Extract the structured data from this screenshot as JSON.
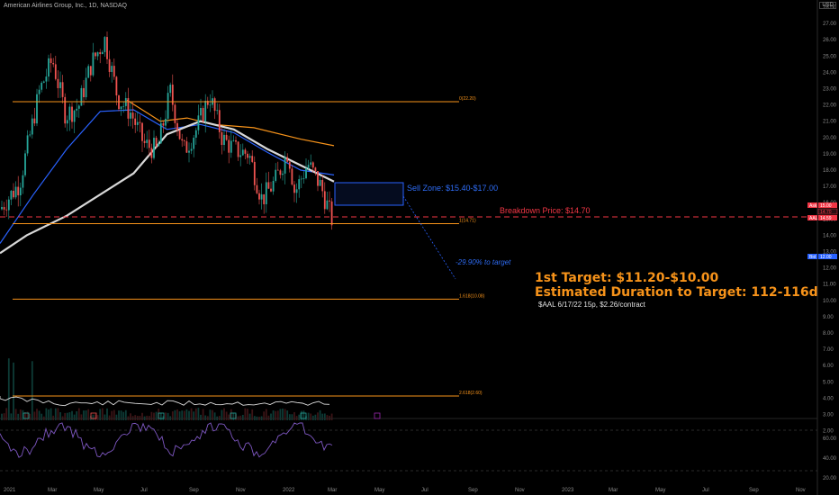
{
  "header": {
    "title": "American Airlines Group, Inc., 1D, NASDAQ",
    "currency": "USD"
  },
  "annotations": {
    "sell_zone": "Sell Zone: $15.40-$17.00",
    "breakdown": "Breakdown Price: $14.70",
    "pct_target": "-29.90% to target",
    "target1": "1st Target: $11.20-$10.00",
    "duration": "Estimated Duration to Target: 112-116d",
    "option": "$AAL 6/17/22 15p, $2.26/contract"
  },
  "fib": [
    {
      "label": "0(22.20)",
      "value": 22.2
    },
    {
      "label": "1(14.71)",
      "value": 14.71
    },
    {
      "label": "1.618(10.08)",
      "value": 10.08
    },
    {
      "label": "2.618(2.60)",
      "value": 2.6
    }
  ],
  "price_tags": {
    "ask": "Ask",
    "ask_val": "15.00",
    "mid_val": "14.70",
    "aal": "AAL",
    "aal_val": "14.59",
    "bid": "Bid",
    "bid_val": "12.00"
  },
  "colors": {
    "bg": "#000000",
    "orange": "#f7931a",
    "blue": "#2962ff",
    "red": "#f23645",
    "purple": "#7e57c2"
  },
  "chart_data": {
    "type": "candlestick",
    "title": "American Airlines Group, Inc., 1D, NASDAQ",
    "x_ticks": [
      "2021",
      "Mar",
      "May",
      "Jul",
      "Sep",
      "Nov",
      "2022",
      "Mar",
      "May",
      "Jul",
      "Sep",
      "Nov",
      "2023",
      "Mar",
      "May",
      "Jul",
      "Sep",
      "Nov"
    ],
    "y_ticks": [
      "28.00",
      "27.00",
      "26.00",
      "25.00",
      "24.00",
      "23.00",
      "22.00",
      "21.00",
      "20.00",
      "19.00",
      "18.00",
      "17.00",
      "16.00",
      "15.00",
      "14.00",
      "13.00",
      "12.00",
      "11.00",
      "10.00",
      "9.00",
      "8.00",
      "7.00",
      "6.00",
      "5.00",
      "4.00",
      "3.00",
      "2.00"
    ],
    "ylim": [
      1.5,
      28.5
    ],
    "rsi_ticks": [
      "60.00",
      "40.00",
      "20.00"
    ],
    "price_path": [
      [
        0,
        15.6
      ],
      [
        0.03,
        17.2
      ],
      [
        0.06,
        22.8
      ],
      [
        0.08,
        24.8
      ],
      [
        0.1,
        21.4
      ],
      [
        0.12,
        21.9
      ],
      [
        0.14,
        24.6
      ],
      [
        0.16,
        26.0
      ],
      [
        0.18,
        22.4
      ],
      [
        0.2,
        21.5
      ],
      [
        0.22,
        19.6
      ],
      [
        0.24,
        19.2
      ],
      [
        0.26,
        22.8
      ],
      [
        0.28,
        19.1
      ],
      [
        0.3,
        20.5
      ],
      [
        0.32,
        22.6
      ],
      [
        0.34,
        19.9
      ],
      [
        0.36,
        19.2
      ],
      [
        0.38,
        19.0
      ],
      [
        0.4,
        16.2
      ],
      [
        0.42,
        17.3
      ],
      [
        0.44,
        19.2
      ],
      [
        0.45,
        16.6
      ],
      [
        0.47,
        18.4
      ],
      [
        0.49,
        17.0
      ],
      [
        0.51,
        14.6
      ]
    ],
    "ma_white": [
      [
        0,
        12.9
      ],
      [
        0.04,
        14.0
      ],
      [
        0.1,
        15.2
      ],
      [
        0.2,
        17.8
      ],
      [
        0.25,
        20.2
      ],
      [
        0.3,
        21.0
      ],
      [
        0.35,
        20.5
      ],
      [
        0.4,
        19.3
      ],
      [
        0.45,
        18.3
      ],
      [
        0.5,
        17.3
      ]
    ],
    "ma_orange": [
      [
        0.19,
        22.3
      ],
      [
        0.24,
        21.0
      ],
      [
        0.28,
        21.2
      ],
      [
        0.32,
        20.8
      ],
      [
        0.38,
        20.6
      ],
      [
        0.45,
        19.9
      ],
      [
        0.5,
        19.5
      ]
    ],
    "ma_blue": [
      [
        0,
        13.5
      ],
      [
        0.05,
        16.5
      ],
      [
        0.1,
        19.3
      ],
      [
        0.15,
        21.6
      ],
      [
        0.2,
        21.7
      ],
      [
        0.25,
        20.5
      ],
      [
        0.3,
        20.8
      ],
      [
        0.35,
        20.3
      ],
      [
        0.4,
        19.1
      ],
      [
        0.45,
        18.0
      ],
      [
        0.5,
        17.7
      ]
    ]
  }
}
